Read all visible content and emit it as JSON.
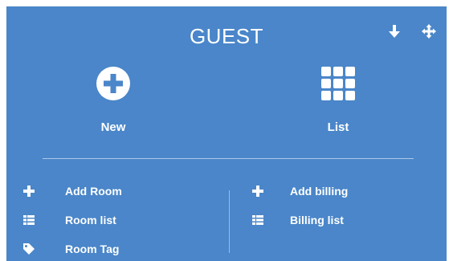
{
  "panel": {
    "title": "GUEST",
    "header_icons": [
      "arrow-down-icon",
      "move-icon"
    ],
    "background": "#4a86c9"
  },
  "actions": {
    "new": {
      "label": "New",
      "icon": "plus-circle-icon"
    },
    "list": {
      "label": "List",
      "icon": "grid-icon"
    }
  },
  "menu_left": [
    {
      "label": "Add Room",
      "icon": "plus-icon"
    },
    {
      "label": "Room list",
      "icon": "table-list-icon"
    },
    {
      "label": "Room Tag",
      "icon": "tag-icon"
    }
  ],
  "menu_right": [
    {
      "label": "Add billing",
      "icon": "plus-icon"
    },
    {
      "label": "Billing list",
      "icon": "table-list-icon"
    }
  ]
}
